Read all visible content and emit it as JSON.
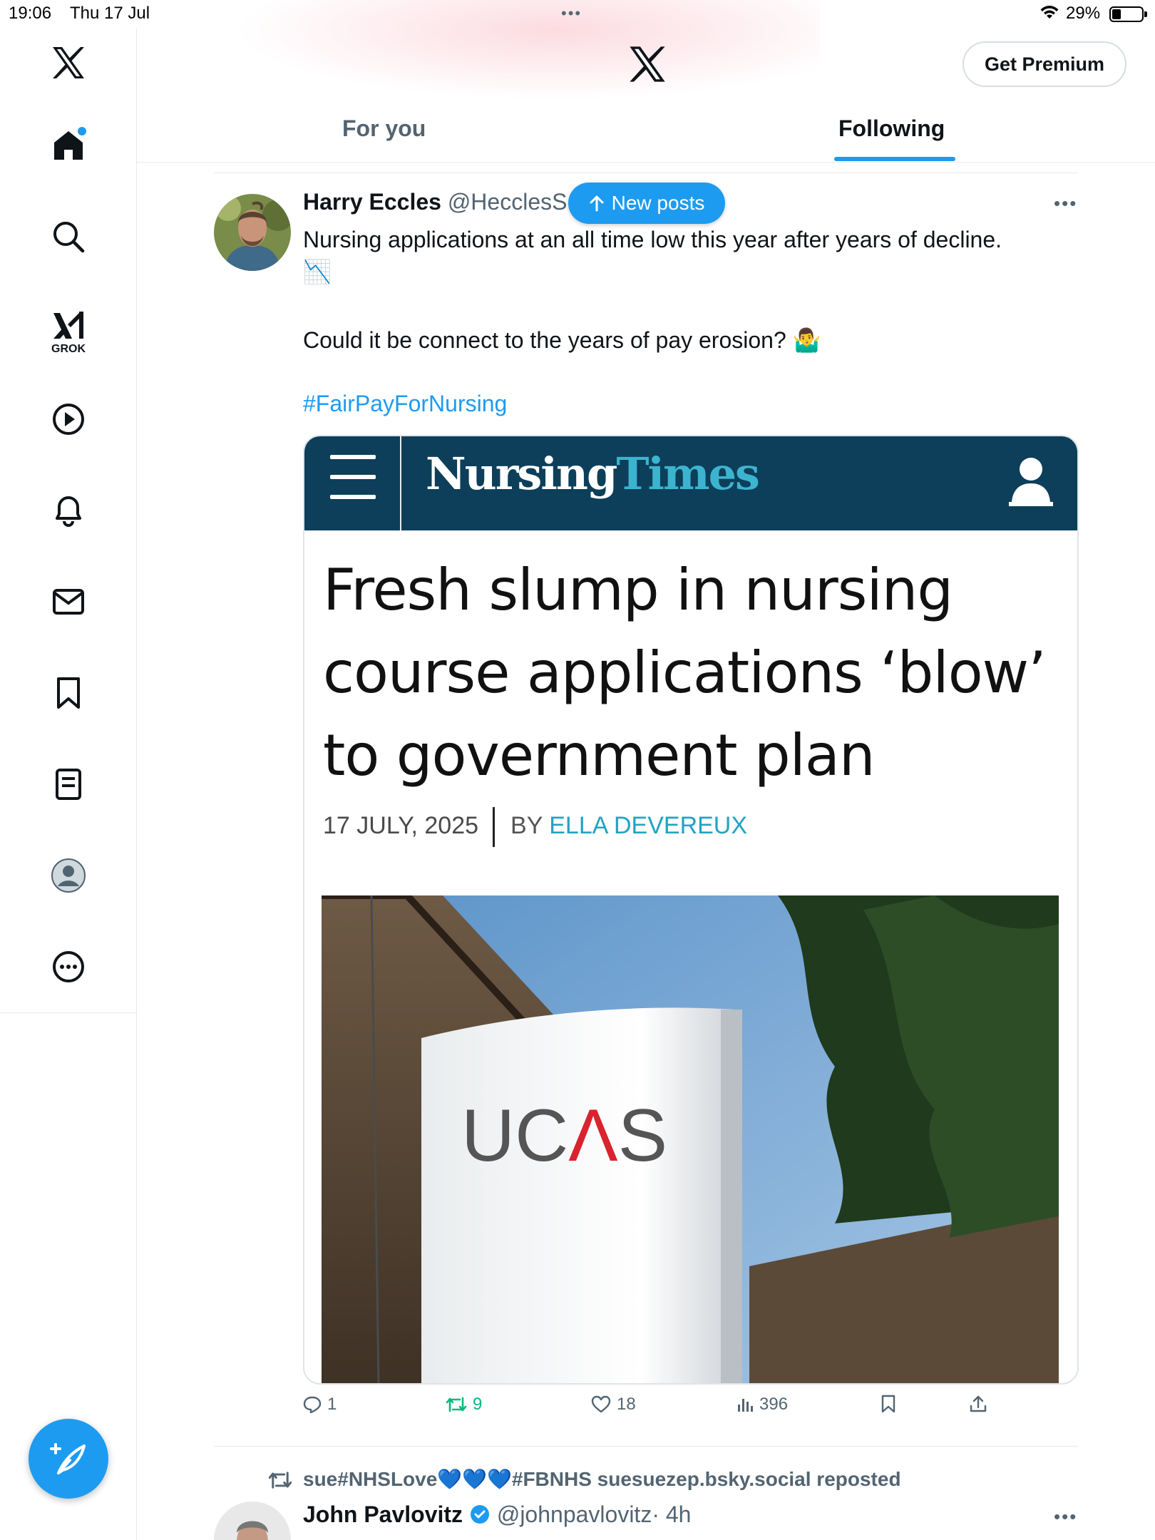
{
  "status_bar": {
    "time": "19:06",
    "date": "Thu 17 Jul",
    "battery": "29%",
    "battery_level": 0.29
  },
  "header": {
    "premium_label": "Get Premium",
    "tabs": [
      {
        "label": "For you",
        "active": false
      },
      {
        "label": "Following",
        "active": true
      }
    ]
  },
  "sidebar": {
    "items": [
      {
        "icon": "x-logo-icon"
      },
      {
        "icon": "home-icon",
        "notification_dot": true
      },
      {
        "icon": "search-icon"
      },
      {
        "icon": "grok-icon",
        "label": "GROK"
      },
      {
        "icon": "play-icon"
      },
      {
        "icon": "bell-icon"
      },
      {
        "icon": "mail-icon"
      },
      {
        "icon": "bookmark-icon"
      },
      {
        "icon": "lists-icon"
      },
      {
        "icon": "profile-icon"
      },
      {
        "icon": "more-icon"
      }
    ],
    "compose_icon": "compose-icon"
  },
  "new_posts_label": "New posts",
  "tweet": {
    "author_name": "Harry Eccles",
    "author_handle": "@HecclesS",
    "text_line1": "Nursing applications at an all time low this year after years of decline.",
    "emoji1": "📉",
    "text_line2": "Could it be connect to the years of pay erosion? 🤷‍♂️",
    "hashtag": "#FairPayForNursing",
    "card": {
      "site_name_part1": "Nursing",
      "site_name_part2": "Times",
      "headline_line1": "Fresh slump in nursing",
      "headline_line2": "course applications ‘blow’",
      "headline_line3": "to government plan",
      "date": "17 JULY, 2025",
      "by": "BY",
      "author": "ELLA DEVEREUX",
      "photo_sign_text_1": "UC",
      "photo_sign_text_2": "Λ",
      "photo_sign_text_3": "S"
    },
    "actions": {
      "replies": "1",
      "reposts": "9",
      "likes": "18",
      "views": "396"
    }
  },
  "next_tweet": {
    "repost_by": "sue#NHSLove💙💙💙#FBNHS suesuezep.bsky.social reposted",
    "author_name": "John Pavlovitz",
    "author_handle": "@johnpavlovitz",
    "time": "· 4h"
  },
  "colors": {
    "accent": "#1d9bf0",
    "repost_green": "#00ba7c",
    "nursing_times_navy": "#0d3f5a",
    "nursing_times_teal": "#3cb4d0"
  }
}
